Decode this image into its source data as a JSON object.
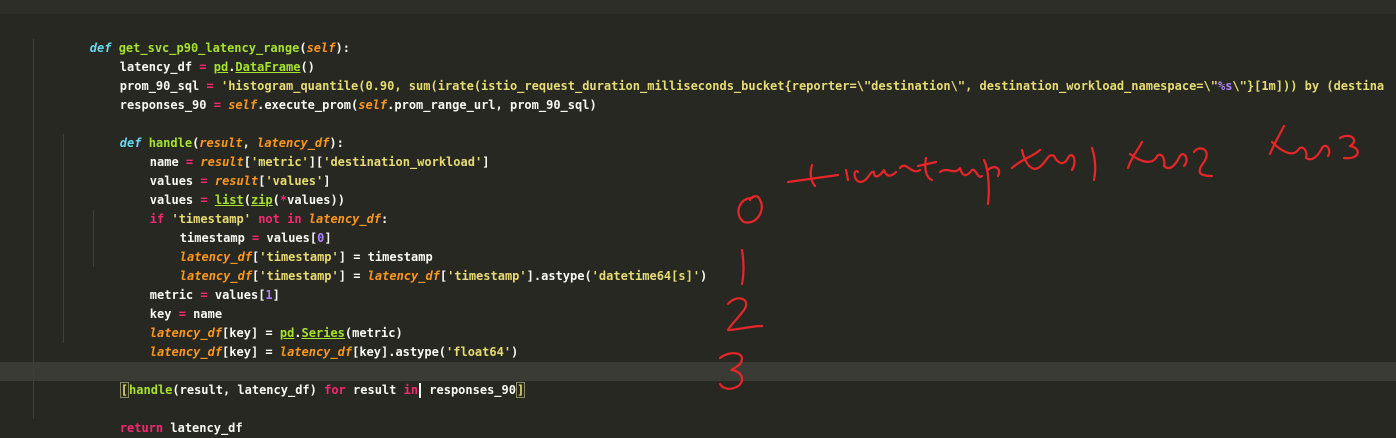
{
  "editor": {
    "lines": [
      {
        "l1": "def",
        "l2": " get_svc_p90_latency_range",
        "l3": "(",
        "l4": "self",
        "l5": "):"
      },
      {
        "a": "latency_df",
        "b": " = ",
        "c": "pd",
        "d": ".",
        "e": "DataFrame",
        "f": "()"
      },
      {
        "a": "prom_90_sql",
        "b": " = ",
        "c": "'histogram_quantile(0.90, sum(irate(istio_request_duration_milliseconds_bucket{reporter=\\\"destination\\\", destination_workload_namespace=\\\"",
        "d": "%s",
        "e": "\\\"}[1m])) by (destina"
      },
      {
        "a": "responses_90",
        "b": " = ",
        "c": "self",
        "d": ".execute_prom(",
        "e": "self",
        "f": ".prom_range_url, prom_90_sql)"
      },
      {},
      {
        "a": "def",
        "b": " handle",
        "c": "(",
        "d": "result",
        "e": ", ",
        "f": "latency_df",
        "g": "):"
      },
      {
        "a": "name",
        "b": " = ",
        "c": "result",
        "d": "[",
        "e": "'metric'",
        "f": "][",
        "g": "'destination_workload'",
        "h": "]"
      },
      {
        "a": "values",
        "b": " = ",
        "c": "result",
        "d": "[",
        "e": "'values'",
        "f": "]"
      },
      {
        "a": "values",
        "b": " = ",
        "c": "list",
        "d": "(",
        "e": "zip",
        "f": "(",
        "g": "*",
        "h": "values))"
      },
      {
        "a": "if",
        "b": " ",
        "c": "'timestamp'",
        "d": " not in ",
        "e": "latency_df",
        "f": ":"
      },
      {
        "a": "timestamp",
        "b": " = ",
        "c": "values[",
        "d": "0",
        "e": "]"
      },
      {
        "a": "latency_df",
        "b": "[",
        "c": "'timestamp'",
        "d": "] = timestamp"
      },
      {
        "a": "latency_df",
        "b": "[",
        "c": "'timestamp'",
        "d": "] = ",
        "e": "latency_df",
        "f": "[",
        "g": "'timestamp'",
        "h": "].astype(",
        "i": "'datetime64[s]'",
        "j": ")"
      },
      {
        "a": "metric",
        "b": " = ",
        "c": "values[",
        "d": "1",
        "e": "]"
      },
      {
        "a": "key",
        "b": " = ",
        "c": "name"
      },
      {
        "a": "latency_df",
        "b": "[key] = ",
        "c": "pd",
        "d": ".",
        "e": "Series",
        "f": "(metric)"
      },
      {
        "a": "latency_df",
        "b": "[key] = ",
        "c": "latency_df",
        "d": "[key].astype(",
        "e": "'float64'",
        "f": ")"
      },
      {},
      {
        "a": "[",
        "b": "handle",
        "c": "(result, latency_df) ",
        "d": "for",
        "e": " result ",
        "f": "in",
        "g": " responses_90",
        "h": "]"
      },
      {},
      {
        "a": "return",
        "b": " latency_df"
      }
    ]
  },
  "annotations": {
    "header_note": "timestamp des1 des2 des3",
    "row_numbers": [
      "0",
      "1",
      "2",
      "3"
    ],
    "ink_color": "#e8262a"
  },
  "theme": {
    "background": "#272822",
    "keyword": "#66d9ef",
    "function": "#a6e22e",
    "parameter": "#fd971f",
    "operator": "#f92672",
    "string": "#e6db74",
    "number": "#ae81ff"
  }
}
